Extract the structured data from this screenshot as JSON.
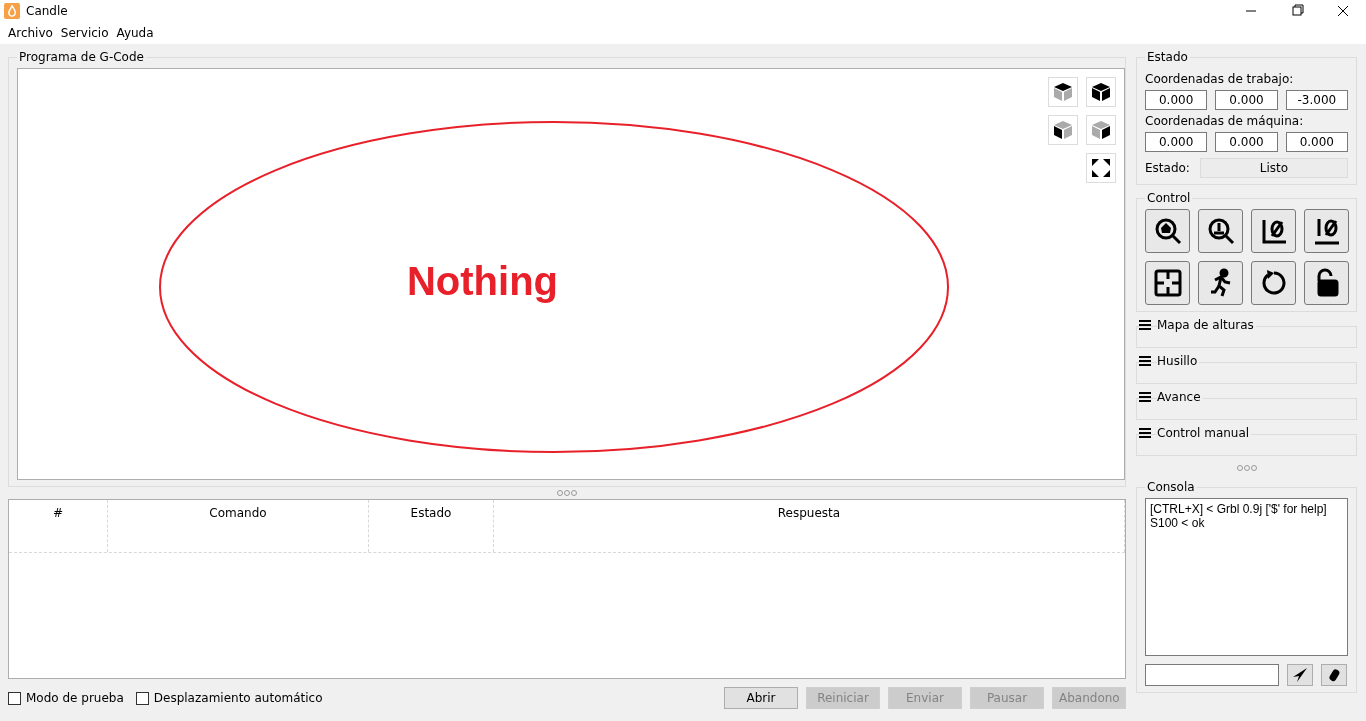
{
  "window": {
    "title": "Candle"
  },
  "menu": [
    "Archivo",
    "Servicio",
    "Ayuda"
  ],
  "gcode_panel": {
    "title": "Programa de G-Code",
    "overlay_text": "Nothing"
  },
  "table": {
    "columns": [
      "#",
      "Comando",
      "Estado",
      "Respuesta"
    ]
  },
  "options": [
    {
      "label": "Modo de prueba",
      "checked": false
    },
    {
      "label": "Desplazamiento automático",
      "checked": false
    }
  ],
  "actions": [
    {
      "label": "Abrir",
      "disabled": false
    },
    {
      "label": "Reiniciar",
      "disabled": true
    },
    {
      "label": "Enviar",
      "disabled": true
    },
    {
      "label": "Pausar",
      "disabled": true
    },
    {
      "label": "Abandono",
      "disabled": true
    }
  ],
  "status": {
    "title": "Estado",
    "work_label": "Coordenadas de trabajo:",
    "work": [
      "0.000",
      "0.000",
      "-3.000"
    ],
    "machine_label": "Coordenadas de máquina:",
    "machine": [
      "0.000",
      "0.000",
      "0.000"
    ],
    "state_label": "Estado:",
    "state": "Listo"
  },
  "control": {
    "title": "Control"
  },
  "sections": [
    "Mapa de alturas",
    "Husillo",
    "Avance",
    "Control manual"
  ],
  "console": {
    "title": "Consola",
    "lines": [
      "[CTRL+X] < Grbl 0.9j ['$' for help]",
      "S100 < ok"
    ]
  }
}
